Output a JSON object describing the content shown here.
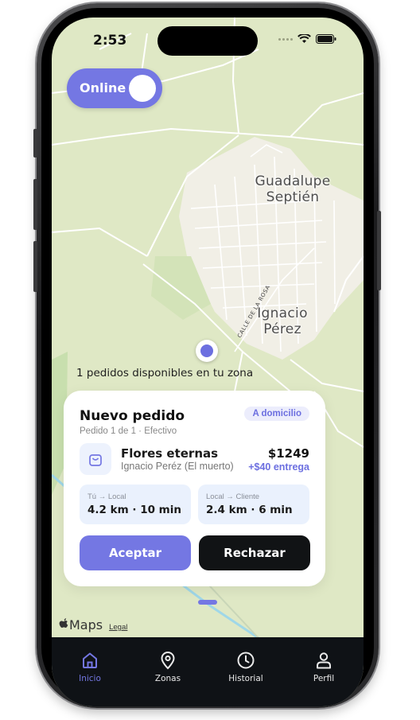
{
  "status_bar": {
    "time": "2:53"
  },
  "toggle": {
    "label": "Online"
  },
  "map": {
    "town_1": [
      "Guadalupe",
      "Septién"
    ],
    "town_2": [
      "Ignacio",
      "Pérez"
    ],
    "street": "CALLE DE LA ROSA"
  },
  "zone_message": "1 pedidos disponibles en tu zona",
  "order": {
    "title": "Nuevo pedido",
    "subtitle": "Pedido 1 de 1 · Efectivo",
    "badge": "A domicilio",
    "item_name": "Flores eternas",
    "client": "Ignacio Peréz (El muerto)",
    "price": "$1249",
    "delivery_fee": "+$40 entrega",
    "distance_to_store": {
      "label": "Tú → Local",
      "value": "4.2 km · 10 min"
    },
    "distance_to_client": {
      "label": "Local → Cliente",
      "value": "2.4 km · 6 min"
    },
    "accept_label": "Aceptar",
    "reject_label": "Rechazar"
  },
  "maps_attribution": {
    "brand": "Maps",
    "legal": "Legal"
  },
  "tabs": [
    {
      "label": "Inicio",
      "icon": "home-icon",
      "active": true
    },
    {
      "label": "Zonas",
      "icon": "map-pin-icon",
      "active": false
    },
    {
      "label": "Historial",
      "icon": "clock-icon",
      "active": false
    },
    {
      "label": "Perfil",
      "icon": "user-icon",
      "active": false
    }
  ],
  "colors": {
    "accent": "#7477e3",
    "map_background": "#dfe8c5",
    "tab_bar": "#0f1216",
    "reject_button": "#111315"
  }
}
